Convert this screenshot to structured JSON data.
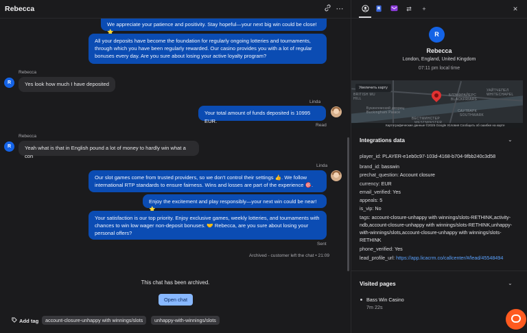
{
  "chat": {
    "title": "Rebecca",
    "messages": [
      {
        "type": "agent",
        "text": "We appreciate your patience and positivity. Stay hopeful—your next big win could be close! ⭐"
      },
      {
        "type": "agent",
        "text": "All your deposits have become the foundation for regularly ongoing lotteries and tournaments, through which you have been regularly rewarded. Our casino provides you with a lot of regular bonuses every day. Are you sure about losing your active loyalty program?"
      },
      {
        "type": "customer",
        "sender": "Rebecca",
        "text": "Yes look how much I have deposited"
      },
      {
        "type": "agent",
        "sender": "Linda",
        "text": "Your total amount of funds deposited is 10995 EUR.",
        "status": "Read"
      },
      {
        "type": "customer",
        "sender": "Rebecca",
        "text": "Yeah what is that in English pound a lot of money to hardly win what a con"
      },
      {
        "type": "agent",
        "sender": "Linda",
        "text": "Our slot games come from trusted providers, so we don't control their settings 👍. We follow international RTP standards to ensure fairness. Wins and losses are part of the experience 🎯."
      },
      {
        "type": "agent",
        "text": "Enjoy the excitement and play responsibly—your next win could be near! ⭐"
      },
      {
        "type": "agent",
        "text": "Your satisfaction is our top priority. Enjoy exclusive games, weekly lotteries, and tournaments with chances to win low wager non-deposit bonuses. 🤝 Rebecca, are you sure about losing your personal offers?",
        "status": "Sent"
      }
    ],
    "archived_meta": "Archived - customer left the chat • 21:09",
    "archived_note": "This chat has been archived.",
    "open_chat_label": "Open chat",
    "add_tag_label": "Add tag",
    "tags": [
      "account-closure-unhappy with winnings/slots",
      "unhappy-with-winnings/slots"
    ],
    "avatar_initial": "R"
  },
  "panel": {
    "avatar_initial": "R",
    "name": "Rebecca",
    "location": "London, England, United Kingdom",
    "local_time": "07:11 pm local time",
    "map": {
      "enlarge_label": "Увеличить карту",
      "footer": "Картографические данные ©2025 Google    Условия    Сообщить об ошибке на карте",
      "labels": [
        "BRITISH MU",
        "HILL",
        "БЛЭКФРАЙЕРС",
        "BLACKFRIARS",
        "УАЙТЧЕПЕЛ",
        "WHITECHAPEL",
        "Букингемский дворец",
        "Buckingham Palace",
        "САУТВАРК",
        "SOUTHWARK",
        "ВЕСТМИНСТЕР",
        "WESTMINSTER"
      ]
    },
    "integrations_title": "Integrations data",
    "integrations": [
      {
        "key": "player_id:",
        "value": "PLAYER-e1eb0c97-103d-4168-b704-9fbb240c3d58"
      },
      {
        "key": "brand_id:",
        "value": "basswin"
      },
      {
        "key": "prechat_question:",
        "value": "Account closure"
      },
      {
        "key": "currency:",
        "value": "EUR"
      },
      {
        "key": "email_verified:",
        "value": "Yes"
      },
      {
        "key": "appeals:",
        "value": "5"
      },
      {
        "key": "is_vip:",
        "value": "No"
      },
      {
        "key": "tags:",
        "value": "account-closure-unhappy with winnings/slots-RETHINK,activity-ndb,account-closure-unhappy with winnings/slots-RETHINK,unhappy-with-winnings/slots,account-closure-unhappy with winnings/slots-RETHINK"
      },
      {
        "key": "phone_verified:",
        "value": "Yes"
      },
      {
        "key": "lead_profile_url:",
        "value": "https://app.licacrm.co/callcenter/#/lead/45548494"
      }
    ],
    "visited_title": "Visited pages",
    "visited": [
      {
        "title": "Bass Win Casino",
        "duration": "7m 22s"
      }
    ]
  },
  "senders": {
    "customer": "Rebecca",
    "agent": "Linda"
  },
  "statuses": {
    "read": "Read",
    "sent": "Sent"
  },
  "colors": {
    "agent_bubble": "#0b4cb3",
    "customer_bubble": "#2c2c2f",
    "accent": "#1463e6",
    "link": "#5aa2ff",
    "fab": "#ff5a1f"
  }
}
